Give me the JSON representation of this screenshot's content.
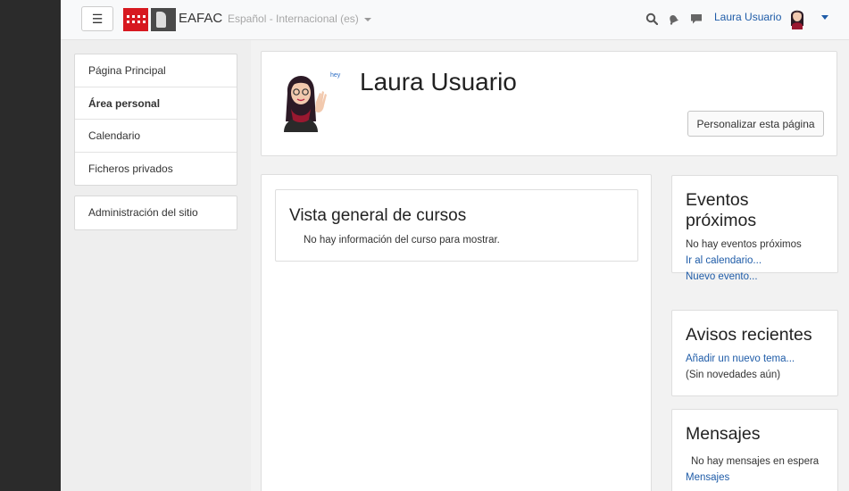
{
  "navbar": {
    "menu_glyph": "☰",
    "site_name": "EAFAC",
    "language": "Español - Internacional (es)",
    "user_name": "Laura Usuario",
    "icons": [
      "search-icon",
      "bell-icon",
      "message-icon",
      "chevron-down-icon"
    ]
  },
  "drawer": {
    "main_items": [
      "Página Principal",
      "Área personal",
      "Calendario",
      "Ficheros privados"
    ],
    "admin_item": "Administración del sitio"
  },
  "header": {
    "name": "Laura Usuario",
    "customize_label": "Personalizar esta página",
    "avatar_caption": "hey"
  },
  "course_overview": {
    "title": "Vista general de cursos",
    "message": "No hay información del curso para mostrar."
  },
  "blocks": {
    "events": {
      "title_line1": "Eventos",
      "title_line2": "próximos",
      "empty": "No hay eventos próximos",
      "link_calendar": "Ir al calendario...",
      "link_new": "Nuevo evento..."
    },
    "news": {
      "title": "Avisos recientes",
      "link_add": "Añadir un nuevo tema...",
      "empty": "(Sin novedades aún)"
    },
    "messages": {
      "title": "Mensajes",
      "empty": "No hay mensajes en espera",
      "link": "Mensajes"
    }
  },
  "colors": {
    "link": "#1f5ca8",
    "brand_red": "#d71920"
  }
}
